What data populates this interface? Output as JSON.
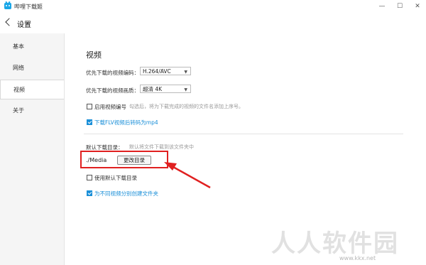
{
  "window": {
    "title": "哔哩下载姬",
    "minimize": "—",
    "maximize": "☐",
    "close": "✕"
  },
  "header": {
    "title": "设置"
  },
  "sidebar": {
    "items": [
      {
        "label": "基本"
      },
      {
        "label": "网络"
      },
      {
        "label": "视频",
        "active": true
      },
      {
        "label": "关于"
      }
    ]
  },
  "main": {
    "section_title": "视频",
    "codec": {
      "label": "优先下载的视频编码：",
      "value": "H.264/AVC"
    },
    "quality": {
      "label": "优先下载的视频画质：",
      "value": "超清 4K"
    },
    "enable_numbering": {
      "label": "启用视频编号",
      "checked": false,
      "hint": "勾选后，将为下载完成的视频的文件名添加上序号。"
    },
    "flv_to_mp4": {
      "label": "下载FLV视频后转码为mp4",
      "checked": true
    },
    "default_dir": {
      "label": "默认下载目录：",
      "hint": "默认将文件下载到该文件夹中",
      "value": "./Media",
      "change_button": "更改目录"
    },
    "use_default_dir": {
      "label": "使用默认下载目录",
      "checked": false
    },
    "per_video_folder": {
      "label": "为不同视频分别创建文件夹",
      "checked": true
    }
  },
  "annotation": {
    "color": "#e02020"
  },
  "watermark": {
    "text": "人人软件园",
    "url": "www.kkx.net"
  }
}
